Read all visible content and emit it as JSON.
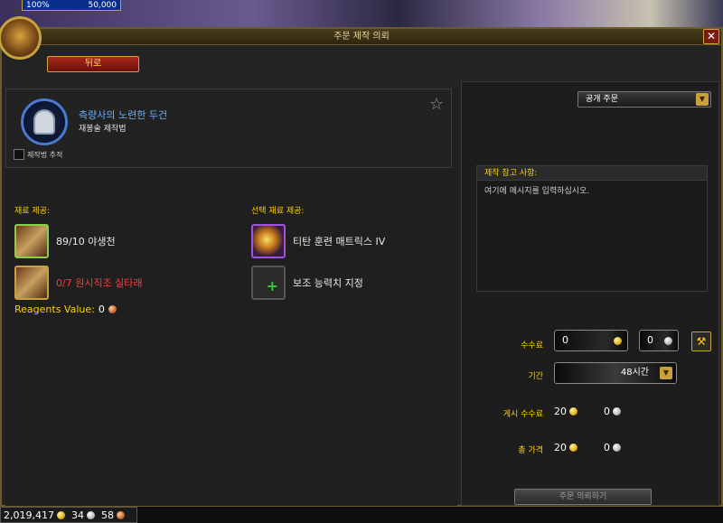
{
  "top_bar": {
    "percent": "100%",
    "value": "50,000"
  },
  "window": {
    "title": "주문 제작 의뢰",
    "close_label": "✕"
  },
  "back_button": "뒤로",
  "recipe": {
    "name": "측량사의 노련한 두건",
    "category": "재봉술 제작법",
    "track_label": "제작법 추적"
  },
  "reagents": {
    "section_label": "재료 제공:",
    "items": [
      {
        "count": "89/10",
        "name": "야생천",
        "insufficient": false
      },
      {
        "count": "0/7",
        "name": "원시직조 실타래",
        "insufficient": true
      }
    ],
    "value_label": "Reagents Value:",
    "value": "0"
  },
  "optional_reagents": {
    "section_label": "선택 재료 제공:",
    "items": [
      {
        "name": "티탄 훈련 매트릭스 IV"
      },
      {
        "name": "보조 능력치 지정"
      }
    ]
  },
  "order_type": {
    "selected": "공개 주문"
  },
  "note": {
    "header": "제작 참고 사항:",
    "placeholder": "여기에 메시지를 입력하십시오."
  },
  "commission": {
    "label": "수수료",
    "gold": "0",
    "silver": "0"
  },
  "duration": {
    "label": "기간",
    "value": "48시간"
  },
  "posting_fee": {
    "label": "게시 수수료",
    "gold": "20",
    "silver": "0"
  },
  "total": {
    "label": "총 가격",
    "gold": "20",
    "silver": "0"
  },
  "submit_button": "주문 의뢰하기",
  "currency": {
    "gold": "2,019,417",
    "silver": "34",
    "copper": "58"
  },
  "colors": {
    "accent_gold": "#ffd100",
    "recipe_blue": "#6ab0ff",
    "insufficient_red": "#ff3a3a",
    "frame_border": "#6b5a2a"
  }
}
